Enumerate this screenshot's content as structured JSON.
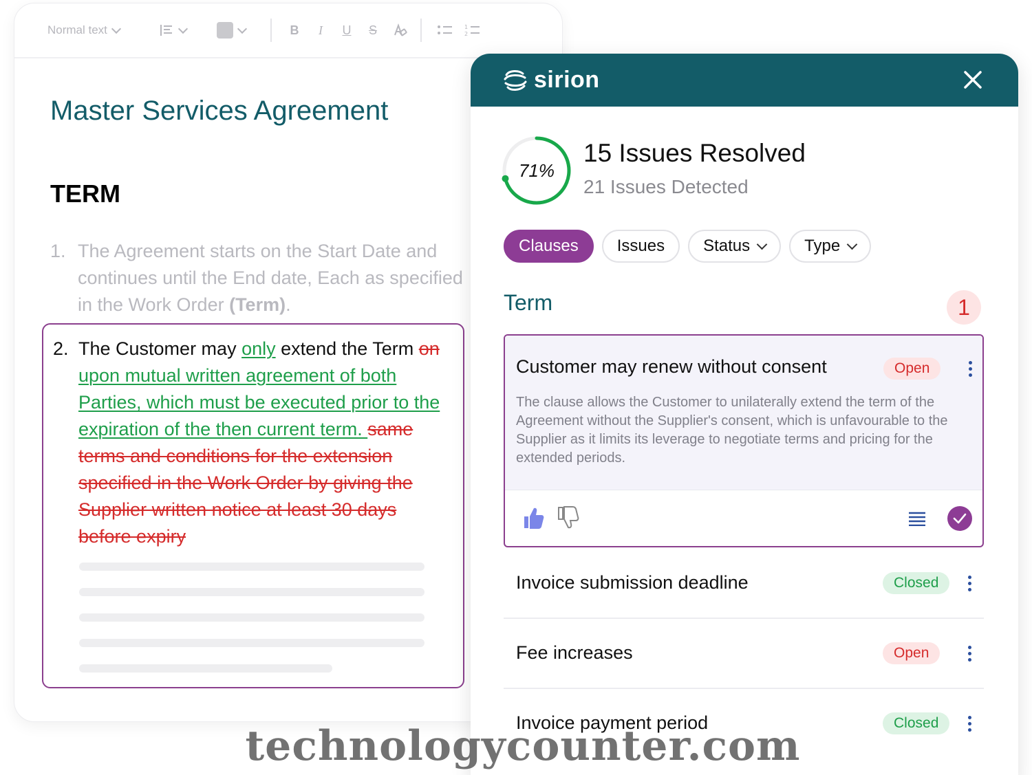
{
  "editor": {
    "toolbar": {
      "text_style": "Normal text",
      "format_buttons": [
        "B",
        "I",
        "U",
        "S"
      ]
    },
    "title": "Master Services Agreement",
    "heading": "TERM",
    "clause1": {
      "number": "1.",
      "text": "The Agreement starts on the Start Date and continues until the End date, Each as specified in the Work Order ",
      "bold": "(Term)",
      "end": "."
    },
    "clause2": {
      "number": "2.",
      "text_a": "The Customer may ",
      "ins_a": "only",
      "text_b": " extend the Term ",
      "del_a": "on",
      "ins_b": "upon mutual written agreement of both Parties, which must be executed prior to the expiration of the then current term. ",
      "del_b": "same terms and conditions for the extension specified in the Work Order by giving the Supplier written notice at least 30 days before expiry"
    }
  },
  "panel": {
    "brand": "sirion",
    "progress_percent": 71,
    "progress_label": "71%",
    "resolved": "15 Issues Resolved",
    "detected": "21 Issues Detected",
    "filters": [
      {
        "label": "Clauses",
        "active": true
      },
      {
        "label": "Issues",
        "active": false
      },
      {
        "label": "Status",
        "active": false
      },
      {
        "label": "Type",
        "active": false
      }
    ],
    "section": "Term",
    "section_count": "1",
    "featured_issue": {
      "title": "Customer may renew without consent",
      "status": "Open",
      "description": "The clause allows the Customer to unilaterally extend the term of the Agreement without the Supplier's consent, which is unfavourable to the Supplier as it limits its leverage to negotiate terms and pricing for the extended periods."
    },
    "issues": [
      {
        "title": "Invoice submission deadline",
        "status": "Closed"
      },
      {
        "title": "Fee increases",
        "status": "Open"
      },
      {
        "title": "Invoice payment period",
        "status": "Closed"
      }
    ]
  },
  "colors": {
    "teal": "#135c68",
    "purple": "#8d3c95",
    "open_text": "#d52b2b",
    "closed_text": "#1e9e4a",
    "progress": "#18a84a"
  },
  "watermark": "technologycounter.com"
}
